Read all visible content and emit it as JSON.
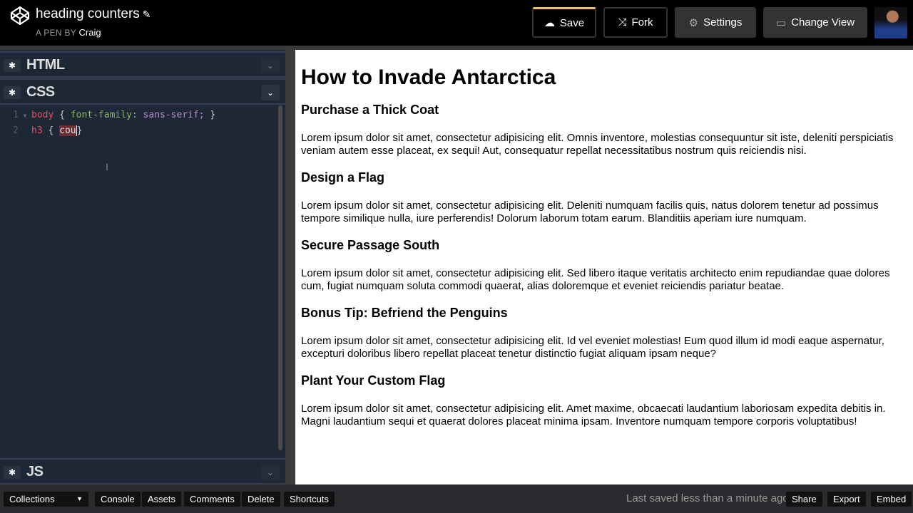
{
  "header": {
    "title": "heading counters",
    "byline_prefix": "A PEN BY",
    "author": "Craig",
    "buttons": {
      "save": "Save",
      "fork": "Fork",
      "settings": "Settings",
      "change_view": "Change View"
    }
  },
  "panels": {
    "html": "HTML",
    "css": "CSS",
    "js": "JS"
  },
  "editor": {
    "lines": [
      {
        "num": "1",
        "selector": "body",
        "open": " { ",
        "prop": "font-family:",
        "value": " sans-serif;",
        "close": " }"
      },
      {
        "num": "2",
        "selector": "h3",
        "open": " { ",
        "typed": "cou",
        "close": "}"
      }
    ]
  },
  "preview": {
    "title": "How to Invade Antarctica",
    "sections": [
      {
        "heading": "Purchase a Thick Coat",
        "text": "Lorem ipsum dolor sit amet, consectetur adipisicing elit. Omnis inventore, molestias consequuntur sit iste, deleniti perspiciatis veniam autem esse placeat, ex sequi! Aut, consequatur repellat necessitatibus nostrum quis reiciendis nisi."
      },
      {
        "heading": "Design a Flag",
        "text": "Lorem ipsum dolor sit amet, consectetur adipisicing elit. Deleniti numquam facilis quis, natus dolorem tenetur ad possimus tempore similique nulla, iure perferendis! Dolorum laborum totam earum. Blanditiis aperiam iure numquam."
      },
      {
        "heading": "Secure Passage South",
        "text": "Lorem ipsum dolor sit amet, consectetur adipisicing elit. Sed libero itaque veritatis architecto enim repudiandae quae dolores cum, fugiat numquam soluta commodi quaerat, alias doloremque et eveniet reiciendis pariatur beatae."
      },
      {
        "heading": "Bonus Tip: Befriend the Penguins",
        "text": "Lorem ipsum dolor sit amet, consectetur adipisicing elit. Id vel eveniet molestias! Eum quod illum id modi eaque aspernatur, excepturi doloribus libero repellat placeat tenetur distinctio fugiat aliquam ipsam neque?"
      },
      {
        "heading": "Plant Your Custom Flag",
        "text": "Lorem ipsum dolor sit amet, consectetur adipisicing elit. Amet maxime, obcaecati laudantium laboriosam expedita debitis in. Magni laudantium sequi et quaerat dolores placeat minima ipsam. Inventore numquam tempore corporis voluptatibus!"
      }
    ]
  },
  "footer": {
    "collections": "Collections",
    "console": "Console",
    "assets": "Assets",
    "comments": "Comments",
    "delete": "Delete",
    "shortcuts": "Shortcuts",
    "status": "Last saved less than a minute ago",
    "share": "Share",
    "export": "Export",
    "embed": "Embed"
  }
}
